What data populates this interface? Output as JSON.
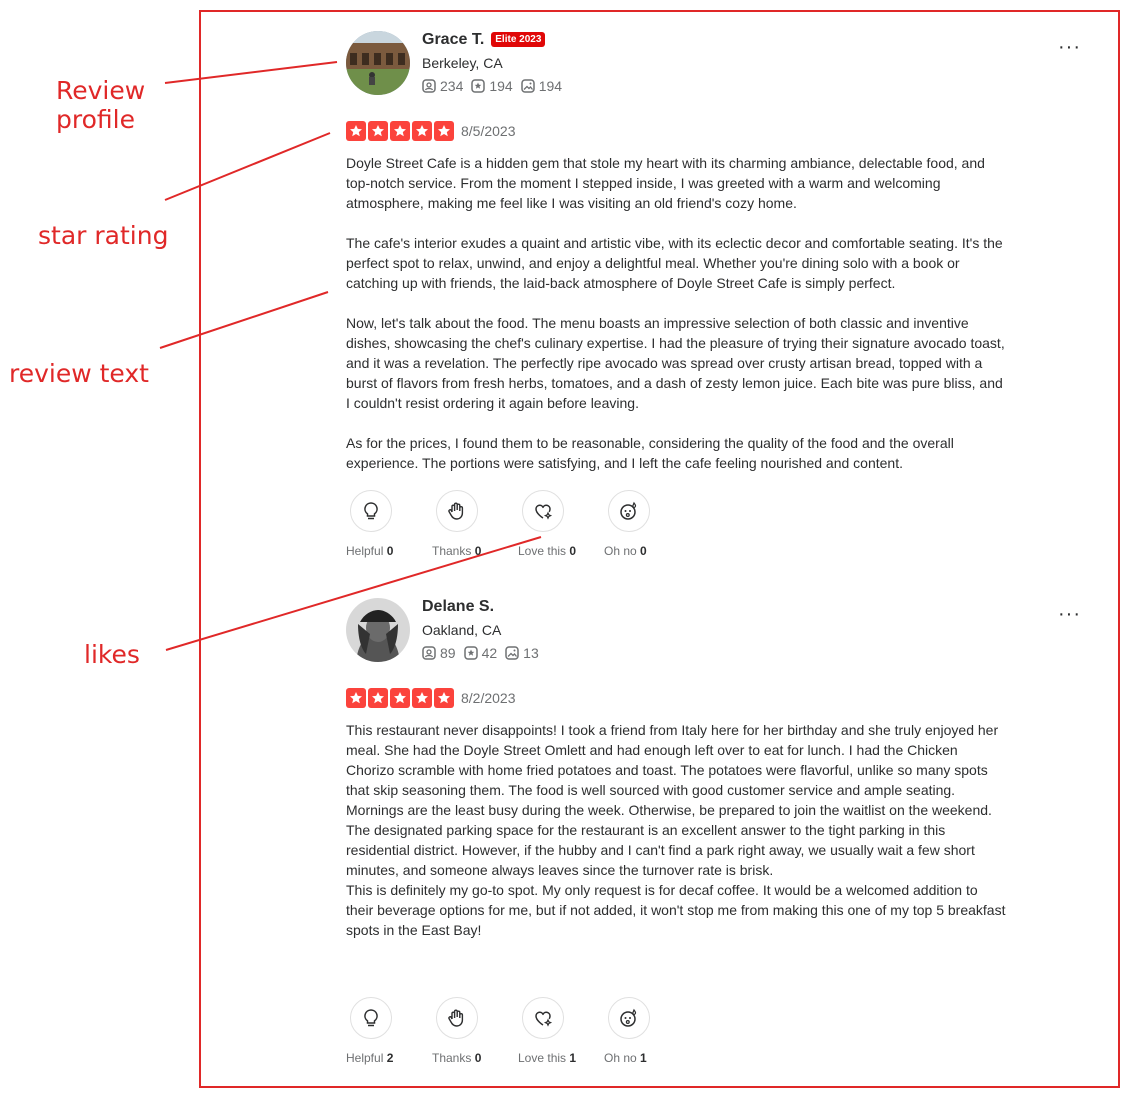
{
  "annotations": {
    "review_profile": [
      "Review",
      "profile"
    ],
    "star_rating": "star rating",
    "review_text": "review text",
    "likes": "likes"
  },
  "colors": {
    "accent": "#e02828",
    "star": "#fb433c",
    "elite": "#e00707"
  },
  "reviews": [
    {
      "name": "Grace T.",
      "badge": "Elite 2023",
      "location": "Berkeley, CA",
      "stats": {
        "friends": "234",
        "reviews": "194",
        "photos": "194"
      },
      "more": "···",
      "rating": 5,
      "date": "8/5/2023",
      "paragraphs": [
        "Doyle Street Cafe is a hidden gem that stole my heart with its charming ambiance, delectable food, and top-notch service. From the moment I stepped inside, I was greeted with a warm and welcoming atmosphere, making me feel like I was visiting an old friend's cozy home.",
        "The cafe's interior exudes a quaint and artistic vibe, with its eclectic decor and comfortable seating. It's the perfect spot to relax, unwind, and enjoy a delightful meal. Whether you're dining solo with a book or catching up with friends, the laid-back atmosphere of Doyle Street Cafe is simply perfect.",
        "Now, let's talk about the food. The menu boasts an impressive selection of both classic and inventive dishes, showcasing the chef's culinary expertise. I had the pleasure of trying their signature avocado toast, and it was a revelation. The perfectly ripe avocado was spread over crusty artisan bread, topped with a burst of flavors from fresh herbs, tomatoes, and a dash of zesty lemon juice. Each bite was pure bliss, and I couldn't resist ordering it again before leaving.",
        "As for the prices, I found them to be reasonable, considering the quality of the food and the overall experience. The portions were satisfying, and I left the cafe feeling nourished and content."
      ],
      "reactions": [
        {
          "label": "Helpful",
          "count": "0"
        },
        {
          "label": "Thanks",
          "count": "0"
        },
        {
          "label": "Love this",
          "count": "0"
        },
        {
          "label": "Oh no",
          "count": "0"
        }
      ]
    },
    {
      "name": "Delane S.",
      "location": "Oakland, CA",
      "stats": {
        "friends": "89",
        "reviews": "42",
        "photos": "13"
      },
      "more": "···",
      "rating": 5,
      "date": "8/2/2023",
      "paragraphs": [
        "This restaurant never disappoints! I took a friend from Italy here for her birthday and she truly enjoyed her meal. She had the Doyle Street Omlett and had enough left over to eat for lunch. I had the Chicken Chorizo scramble with home fried potatoes and toast. The potatoes were flavorful, unlike so many spots that skip seasoning them. The food is well sourced with good customer service and ample seating.",
        "Mornings are the least busy during the week. Otherwise, be prepared to join the waitlist on the weekend.",
        "The designated parking space for the restaurant is an excellent answer to the tight parking in this residential district. However, if the hubby and I can't find a park right away, we usually wait a few short minutes, and someone always leaves since the turnover rate is brisk.",
        "This is definitely my go-to spot. My only request is for decaf coffee. It would be a welcomed addition to their beverage options for me, but if not added, it won't stop me from making this one of my top 5 breakfast spots in the East Bay!"
      ],
      "reactions": [
        {
          "label": "Helpful",
          "count": "2"
        },
        {
          "label": "Thanks",
          "count": "0"
        },
        {
          "label": "Love this",
          "count": "1"
        },
        {
          "label": "Oh no",
          "count": "1"
        }
      ]
    }
  ]
}
